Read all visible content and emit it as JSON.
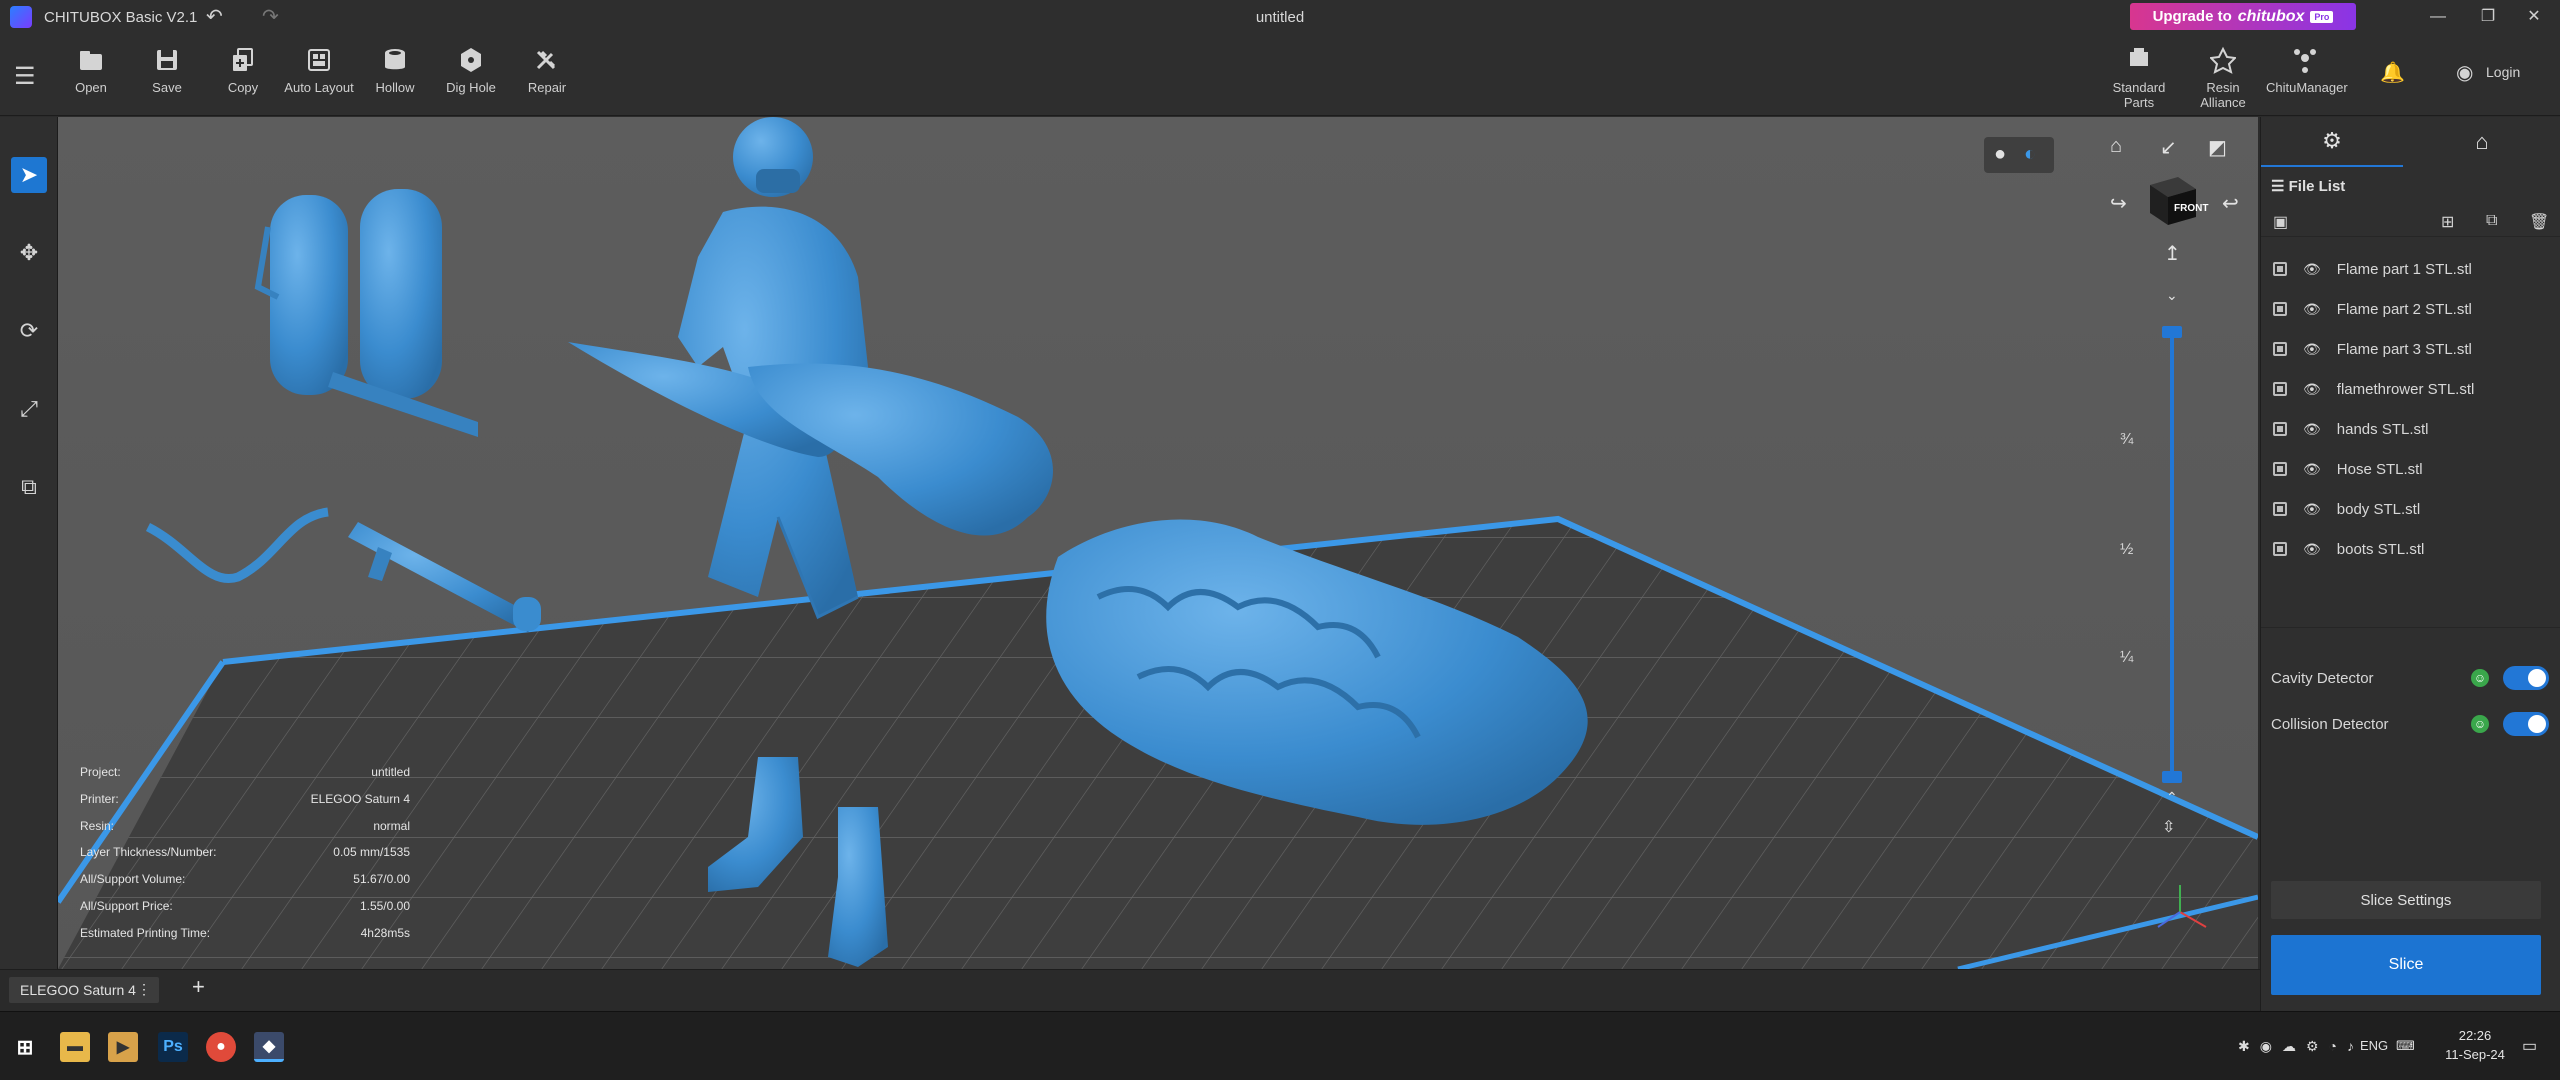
{
  "window": {
    "app_title": "CHITUBOX Basic V2.1",
    "doc_title": "untitled",
    "upgrade_prefix": "Upgrade to",
    "upgrade_brand": "chitubox",
    "upgrade_badge": "Pro",
    "undo_icon": "undo-icon",
    "redo_icon": "redo-icon"
  },
  "toolbar": {
    "tools": [
      {
        "id": "open",
        "label": "Open",
        "icon": "folder-icon"
      },
      {
        "id": "save",
        "label": "Save",
        "icon": "save-icon"
      },
      {
        "id": "copy",
        "label": "Copy",
        "icon": "copy-icon"
      },
      {
        "id": "auto-layout",
        "label": "Auto Layout",
        "icon": "auto-layout-icon"
      },
      {
        "id": "hollow",
        "label": "Hollow",
        "icon": "hollow-icon"
      },
      {
        "id": "dig-hole",
        "label": "Dig Hole",
        "icon": "dig-hole-icon"
      },
      {
        "id": "repair",
        "label": "Repair",
        "icon": "repair-icon"
      }
    ],
    "right_tools": [
      {
        "id": "standard-parts",
        "label": "Standard Parts",
        "icon": "standard-parts-icon"
      },
      {
        "id": "resin-alliance",
        "label": "Resin Alliance",
        "icon": "resin-alliance-icon"
      },
      {
        "id": "chitumanager",
        "label": "ChituManager",
        "icon": "chitumanager-icon"
      }
    ],
    "login_label": "Login"
  },
  "left_tools": [
    "select-icon",
    "move-icon",
    "rotate-icon",
    "scale-icon",
    "mirror-icon"
  ],
  "info": {
    "rows": [
      {
        "label": "Project:",
        "value": "untitled"
      },
      {
        "label": "Printer:",
        "value": "ELEGOO Saturn 4"
      },
      {
        "label": "Resin:",
        "value": "normal"
      },
      {
        "label": "Layer Thickness/Number:",
        "value": "0.05 mm/1535"
      },
      {
        "label": "All/Support Volume:",
        "value": "51.67/0.00"
      },
      {
        "label": "All/Support Price:",
        "value": "1.55/0.00"
      },
      {
        "label": "Estimated Printing Time:",
        "value": "4h28m5s"
      }
    ]
  },
  "view": {
    "cube_label": "FRONT",
    "layer_ticks": [
      "¾",
      "½",
      "¼"
    ]
  },
  "bottom_tabs": {
    "printer": "ELEGOO Saturn 4",
    "add_label": "+"
  },
  "right_panel": {
    "file_list_title": "File List",
    "files": [
      "Flame part 1 STL.stl",
      "Flame part 2 STL.stl",
      "Flame part 3 STL.stl",
      "flamethrower STL.stl",
      "hands STL.stl",
      "Hose STL.stl",
      "body STL.stl",
      "boots STL.stl"
    ],
    "cavity_label": "Cavity Detector",
    "collision_label": "Collision Detector",
    "slice_settings_label": "Slice Settings",
    "slice_label": "Slice"
  },
  "taskbar": {
    "lang": "ENG",
    "time": "22:26",
    "date": "11-Sep-24",
    "ps_label": "Ps"
  },
  "colors": {
    "accent": "#1e77d2",
    "model": "#3f8fd0",
    "viewport": "#5f5f5f",
    "plate": "#404040"
  }
}
